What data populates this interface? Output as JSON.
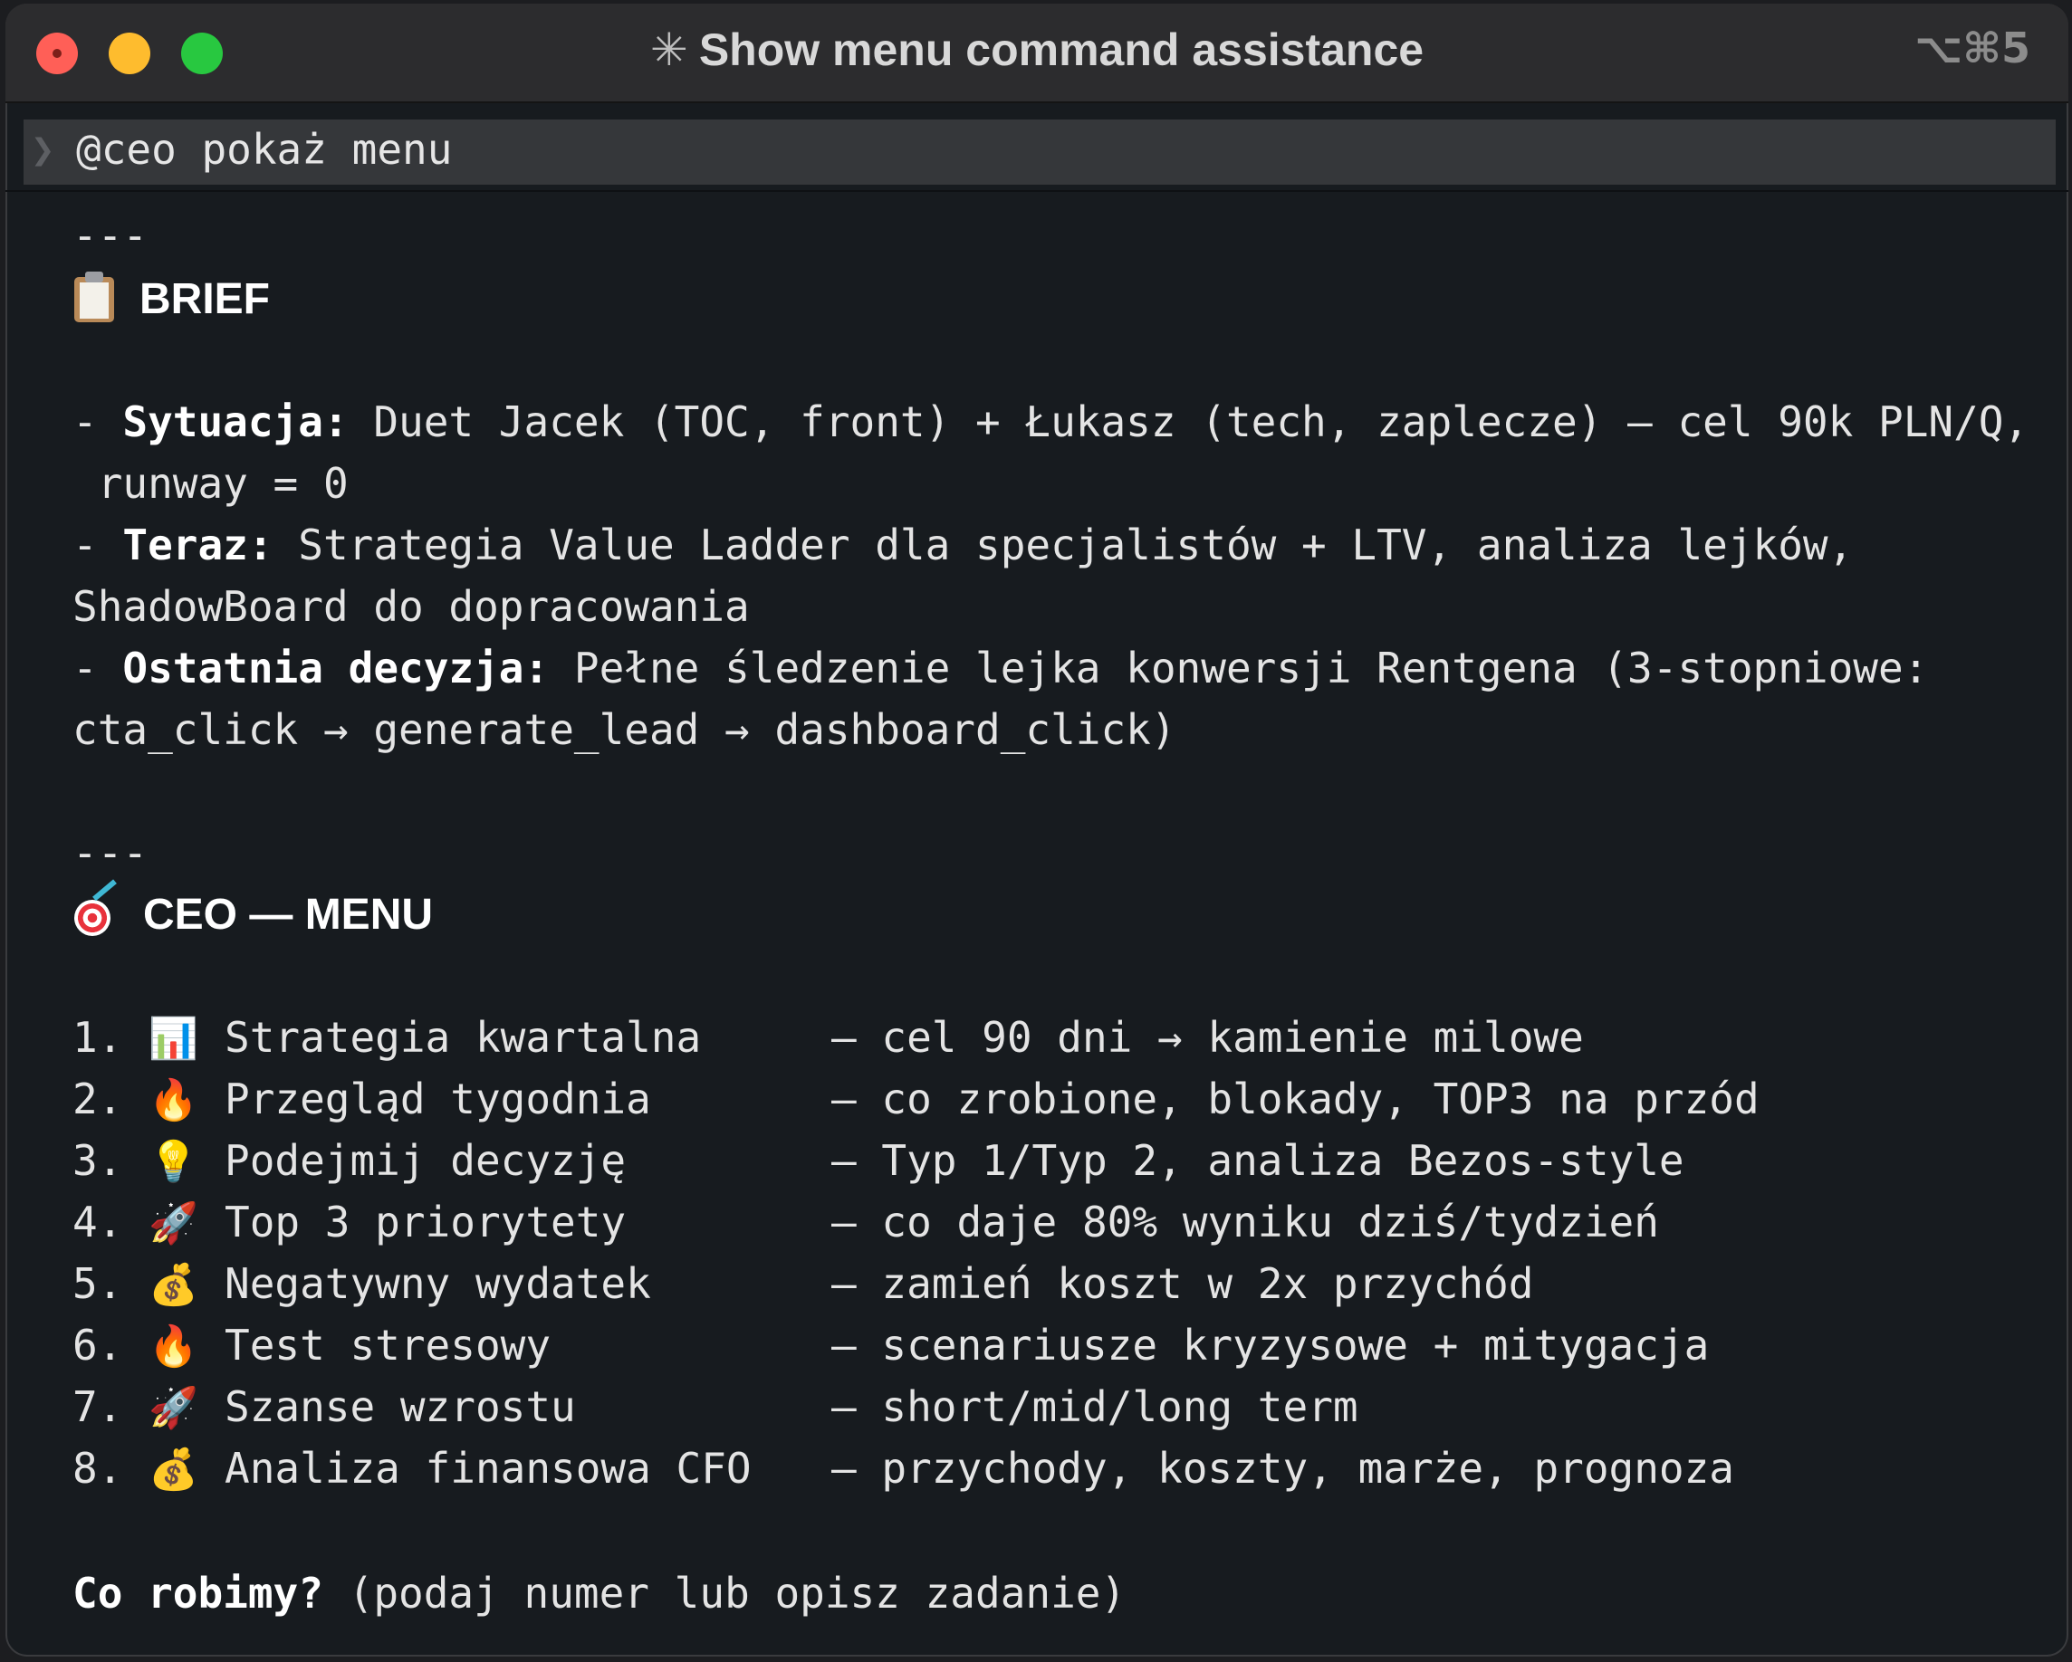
{
  "window": {
    "title": "Show menu command assistance",
    "title_glyph": "✳",
    "shortcut": "⌥⌘5"
  },
  "input": {
    "prompt_glyph": "❯",
    "command": "@ceo pokaż menu"
  },
  "brief": {
    "divider": "---",
    "icon": "clipboard-icon",
    "heading": "BRIEF",
    "situation_label": "Sytuacja:",
    "situation_line1": " Duet Jacek (TOC, front) + Łukasz (tech, zaplecze) — cel 90k PLN/Q,",
    "situation_line2": " runway = 0",
    "now_label": "Teraz:",
    "now_line1": " Strategia Value Ladder dla specjalistów + LTV, analiza lejków,",
    "now_line2": "ShadowBoard do dopracowania",
    "decision_label": "Ostatnia decyzja:",
    "decision_line1": " Pełne śledzenie lejka konwersji Rentgena (3-stopniowe:",
    "decision_line2": "cta_click → generate_lead → dashboard_click)"
  },
  "menu": {
    "divider": "---",
    "icon": "target-icon",
    "heading": "CEO — MENU",
    "items": [
      {
        "num": "1.",
        "emoji": "📊",
        "icon": "chart-icon",
        "label": "Strategia kwartalna",
        "desc": "— cel 90 dni → kamienie milowe"
      },
      {
        "num": "2.",
        "emoji": "🔥",
        "icon": "fire-icon",
        "label": "Przegląd tygodnia",
        "desc": "— co zrobione, blokady, TOP3 na przód"
      },
      {
        "num": "3.",
        "emoji": "💡",
        "icon": "lightbulb-icon",
        "label": "Podejmij decyzję",
        "desc": "— Typ 1/Typ 2, analiza Bezos-style"
      },
      {
        "num": "4.",
        "emoji": "🚀",
        "icon": "rocket-icon",
        "label": "Top 3 priorytety",
        "desc": "— co daje 80% wyniku dziś/tydzień"
      },
      {
        "num": "5.",
        "emoji": "💰",
        "icon": "money-bag-icon",
        "label": "Negatywny wydatek",
        "desc": "— zamień koszt w 2x przychód"
      },
      {
        "num": "6.",
        "emoji": "🔥",
        "icon": "fire-icon",
        "label": "Test stresowy",
        "desc": "— scenariusze kryzysowe + mitygacja"
      },
      {
        "num": "7.",
        "emoji": "🚀",
        "icon": "rocket-icon",
        "label": "Szanse wzrostu",
        "desc": "— short/mid/long term"
      },
      {
        "num": "8.",
        "emoji": "💰",
        "icon": "money-bag-icon",
        "label": "Analiza finansowa CFO",
        "desc": "— przychody, koszty, marże, prognoza"
      }
    ]
  },
  "footer": {
    "question": "Co robimy?",
    "hint": " (podaj numer lub opisz zadanie)"
  },
  "colors": {
    "background": "#171b1f",
    "titlebar": "#2c2c2e",
    "input_bar": "#35373a",
    "text": "#e4e4e4",
    "traffic_red": "#ff5f57",
    "traffic_yellow": "#febc2e",
    "traffic_green": "#28c840"
  }
}
